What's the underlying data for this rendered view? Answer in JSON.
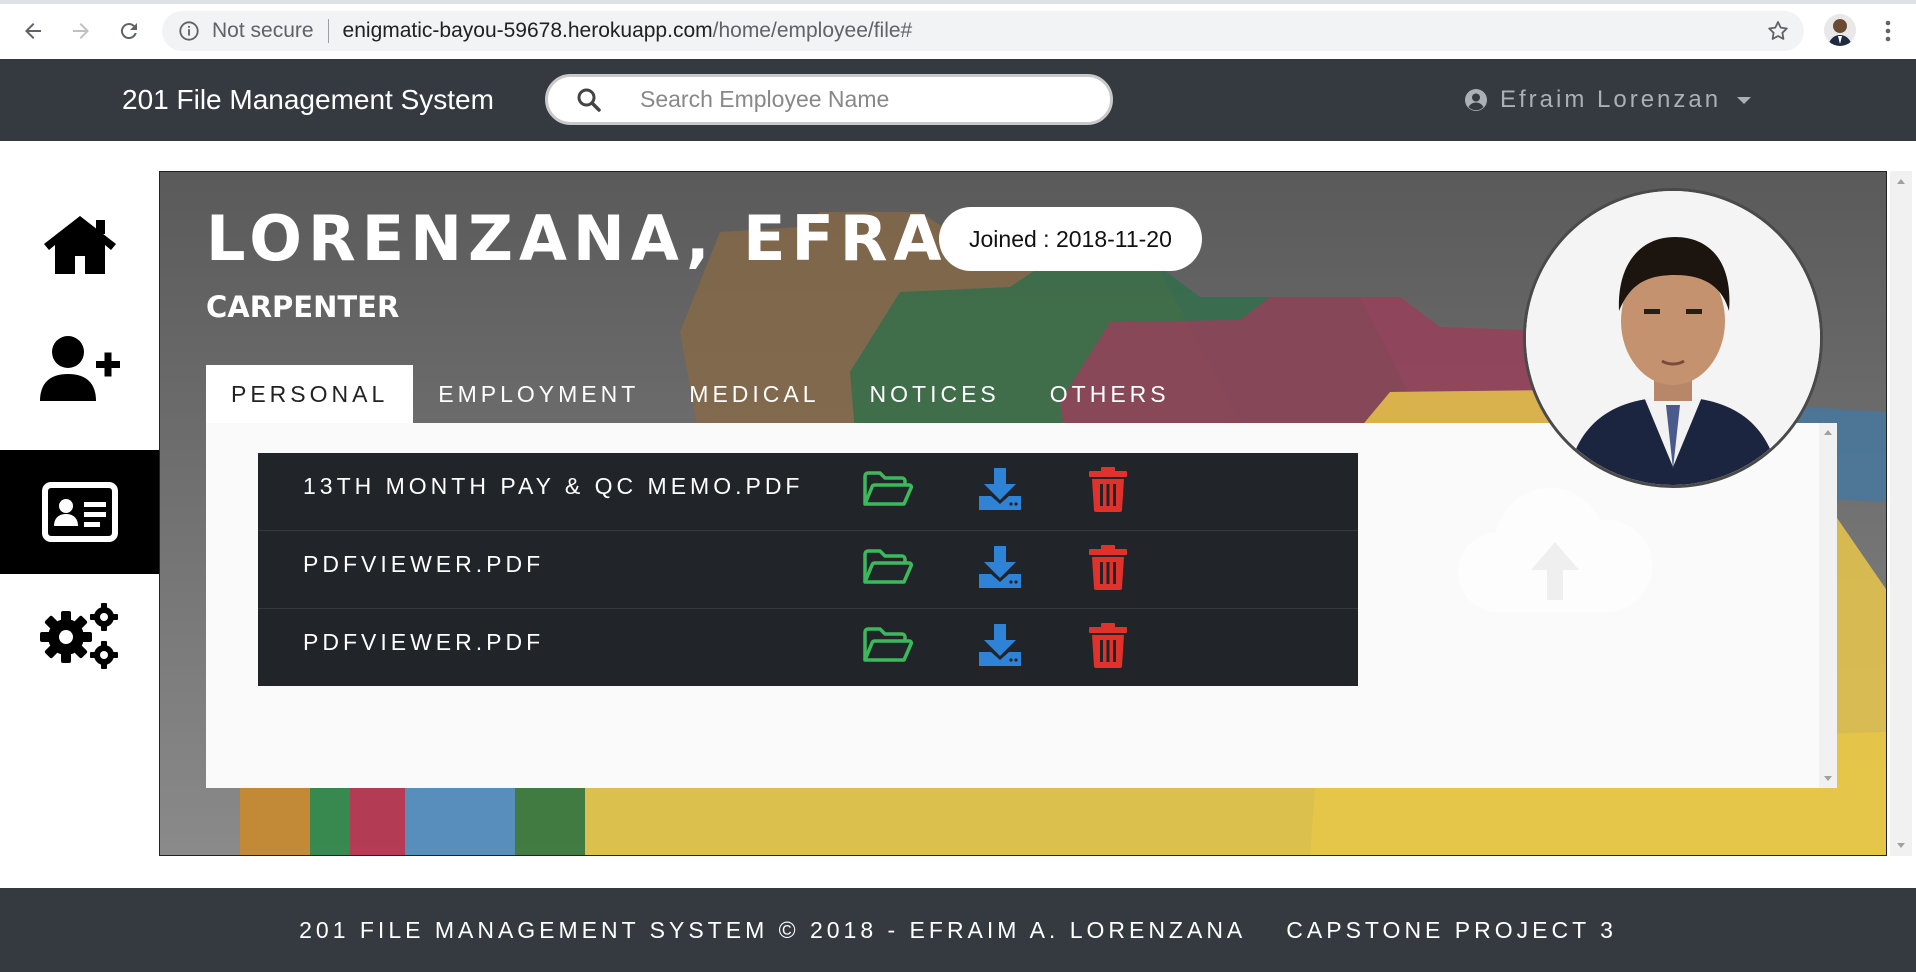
{
  "browser": {
    "security_label": "Not secure",
    "url_host": "enigmatic-bayou-59678.herokuapp.com",
    "url_path": "/home/employee/file#"
  },
  "navbar": {
    "brand": "201 File Management System",
    "search_placeholder": "Search Employee Name",
    "user_name": "Efraim Lorenzan"
  },
  "sidebar": {
    "items": [
      {
        "icon": "home-icon"
      },
      {
        "icon": "add-user-icon"
      },
      {
        "icon": "id-card-icon",
        "active": true
      },
      {
        "icon": "gears-icon"
      }
    ]
  },
  "employee": {
    "name": "LORENZANA, EFRAIM",
    "joined": "Joined : 2018-11-20",
    "position": "CARPENTER"
  },
  "tabs": [
    "PERSONAL",
    "EMPLOYMENT",
    "MEDICAL",
    "NOTICES",
    "OTHERS"
  ],
  "files": [
    {
      "name": "13TH MONTH PAY & QC MEMO.PDF"
    },
    {
      "name": "PDFVIEWER.PDF"
    },
    {
      "name": "PDFVIEWER.PDF"
    }
  ],
  "colors": {
    "open": "#3cb95b",
    "download": "#2f83d6",
    "delete": "#e0312a",
    "navbar": "#343a40"
  },
  "footer": {
    "left": "201 FILE MANAGEMENT SYSTEM © 2018 - EFRAIM A. LORENZANA",
    "right": "CAPSTONE PROJECT 3"
  }
}
